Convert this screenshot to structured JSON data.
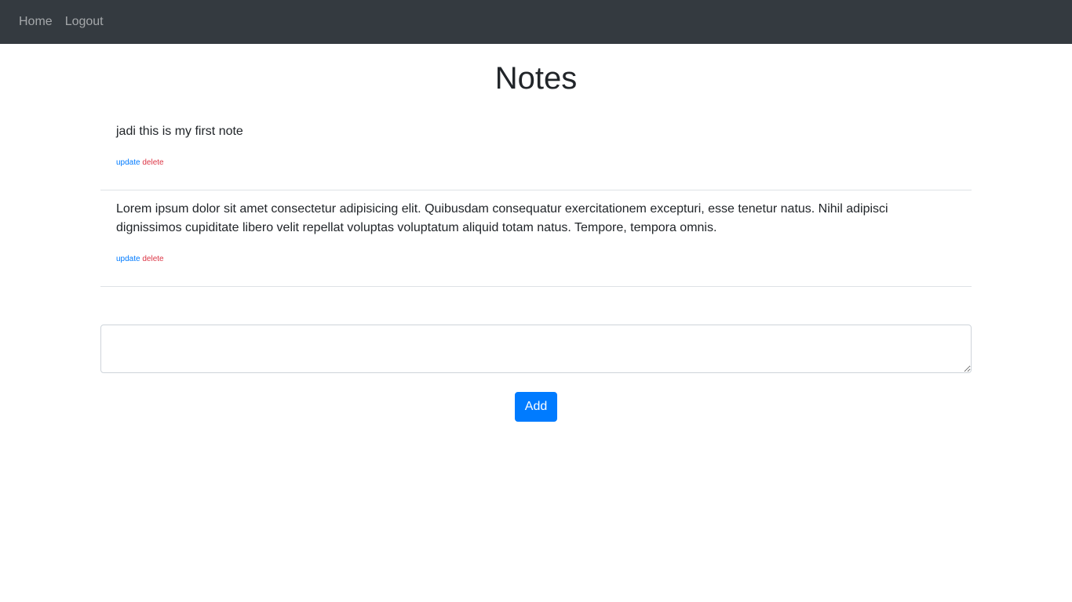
{
  "nav": {
    "items": [
      {
        "label": "Home"
      },
      {
        "label": "Logout"
      }
    ]
  },
  "page": {
    "title": "Notes"
  },
  "notes": [
    {
      "text": "jadi this is my first note",
      "update_label": "update",
      "delete_label": "delete"
    },
    {
      "text": "Lorem ipsum dolor sit amet consectetur adipisicing elit. Quibusdam consequatur exercitationem excepturi, esse tenetur natus. Nihil adipisci dignissimos cupiditate libero velit repellat voluptas voluptatum aliquid totam natus. Tempore, tempora omnis.",
      "update_label": "update",
      "delete_label": "delete"
    }
  ],
  "form": {
    "textarea_value": "",
    "add_label": "Add"
  },
  "colors": {
    "navbar": "#343a40",
    "primary": "#007bff",
    "danger": "#dc3545"
  }
}
